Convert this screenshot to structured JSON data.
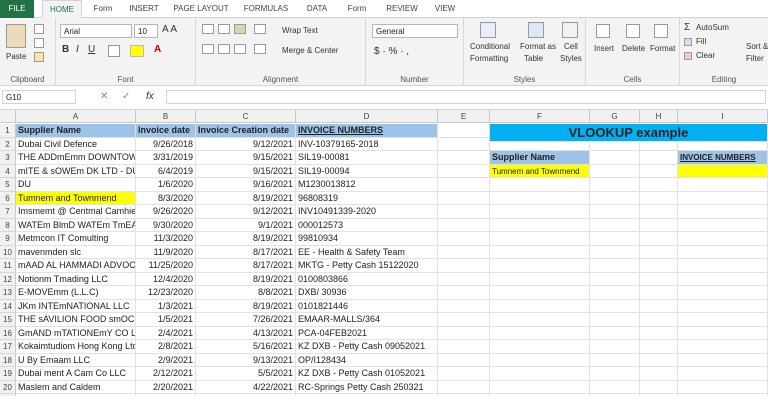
{
  "tabs": [
    "FILE",
    "HOME",
    "Form",
    "INSERT",
    "PAGE LAYOUT",
    "FORMULAS",
    "DATA",
    "Form",
    "REVIEW",
    "VIEW"
  ],
  "ribbon": {
    "clipboard": {
      "label": "Clipboard",
      "paste": "Paste"
    },
    "font": {
      "label": "Font",
      "name": "Arial",
      "size": "10"
    },
    "alignment": {
      "label": "Alignment",
      "wrap": "Wrap Text",
      "merge": "Merge & Center"
    },
    "number": {
      "label": "Number",
      "format": "General",
      "symbols": "$  ·  %  ·  ,"
    },
    "styles": {
      "label": "Styles",
      "cond": [
        "Conditional",
        "Formatting"
      ],
      "table": [
        "Format as",
        "Table"
      ],
      "cell": [
        "Cell",
        "Styles"
      ]
    },
    "cells": {
      "label": "Cells",
      "insert": "Insert",
      "delete": "Delete",
      "format": "Format"
    },
    "editing": {
      "label": "Editing",
      "autosum": "AutoSum",
      "fill": "Fill",
      "clear": "Clear",
      "sort": [
        "Sort &",
        "Filter"
      ]
    }
  },
  "formula_bar": {
    "name_box": "G10",
    "fx": "fx",
    "value": ""
  },
  "columns": [
    "A",
    "B",
    "C",
    "D",
    "E",
    "F",
    "G",
    "H",
    "I"
  ],
  "rows": [
    "1",
    "2",
    "3",
    "4",
    "5",
    "6",
    "7",
    "8",
    "9",
    "10",
    "11",
    "12",
    "13",
    "14",
    "15",
    "16",
    "17",
    "18",
    "19",
    "20",
    "21"
  ],
  "headers": {
    "a": "Supplier Name",
    "b": "Invoice date",
    "c": "Invoice Creation date",
    "d": "INVOICE NUMBERS"
  },
  "data": [
    [
      "Dubai Civil Defence",
      "9/26/2018",
      "9/12/2021",
      "INV-10379165-2018"
    ],
    [
      "THE ADDmEmm DOWNTOWI",
      "3/31/2019",
      "9/15/2021",
      "SIL19-00081"
    ],
    [
      "mITE & sOWEm DK LTD - DU",
      "6/4/2019",
      "9/15/2021",
      "SIL19-00094"
    ],
    [
      "DU",
      "1/6/2020",
      "9/16/2021",
      "M1230013812"
    ],
    [
      "Tumnem and Townmend",
      "8/3/2020",
      "8/19/2021",
      "96808319"
    ],
    [
      "Imsmemt @ Centmal Camhier",
      "9/26/2020",
      "9/12/2021",
      "INV10491339-2020"
    ],
    [
      "WATEm BlmD WATEm TmEA",
      "9/30/2020",
      "9/1/2021",
      "000012573"
    ],
    [
      "Metmcon IT Comulting",
      "11/3/2020",
      "8/19/2021",
      "99810934"
    ],
    [
      "mavenmden slc",
      "11/9/2020",
      "8/17/2021",
      "EE - Health & Safety Team"
    ],
    [
      "mAAD AL HAMMADI ADVOCA",
      "11/25/2020",
      "8/17/2021",
      "MKTG - Petty Cash 15122020"
    ],
    [
      "Notionm Tmading LLC",
      "12/4/2020",
      "8/19/2021",
      "0100803866"
    ],
    [
      "E-MOVEmm (L.L.C)",
      "12/23/2020",
      "8/8/2021",
      "DXB/ 30936"
    ],
    [
      "JKm INTEmNATIONAL LLC",
      "1/3/2021",
      "8/19/2021",
      "0101821446"
    ],
    [
      "THE sAVILION FOOD smOCE",
      "1/5/2021",
      "7/26/2021",
      "EMAAR-MALLS/364"
    ],
    [
      "GmAND mTATIONEmY CO L",
      "2/4/2021",
      "4/13/2021",
      "PCA-04FEB2021"
    ],
    [
      "Kokaimtudiom Hong Kong Ltd",
      "2/8/2021",
      "5/16/2021",
      "KZ DXB - Petty Cash 09052021"
    ],
    [
      "U By Emaam LLC",
      "2/9/2021",
      "9/13/2021",
      "OP/I128434"
    ],
    [
      "Dubai ment A Cam Co LLC",
      "2/12/2021",
      "5/5/2021",
      "KZ DXB - Petty Cash 01052021"
    ],
    [
      "Maslem and Caldem",
      "2/20/2021",
      "4/22/2021",
      "RC-Springs Petty Cash 250321"
    ],
    [
      "mteamamtemLaundmy & Dmy",
      "2/27/2021",
      "4/29/2021",
      "KZAUH - Petty Cash 20042021"
    ]
  ],
  "vlookup": {
    "title": "VLOOKUP example",
    "supplier_label": "Supplier Name",
    "supplier_value": "Tumnem and Townmend",
    "invoice_label": "INVOICE NUMBERS"
  },
  "colors": {
    "excel_green": "#217346",
    "header_blue": "#9dc3e6",
    "title_blue": "#00b0f0",
    "highlight": "#ffff00"
  }
}
